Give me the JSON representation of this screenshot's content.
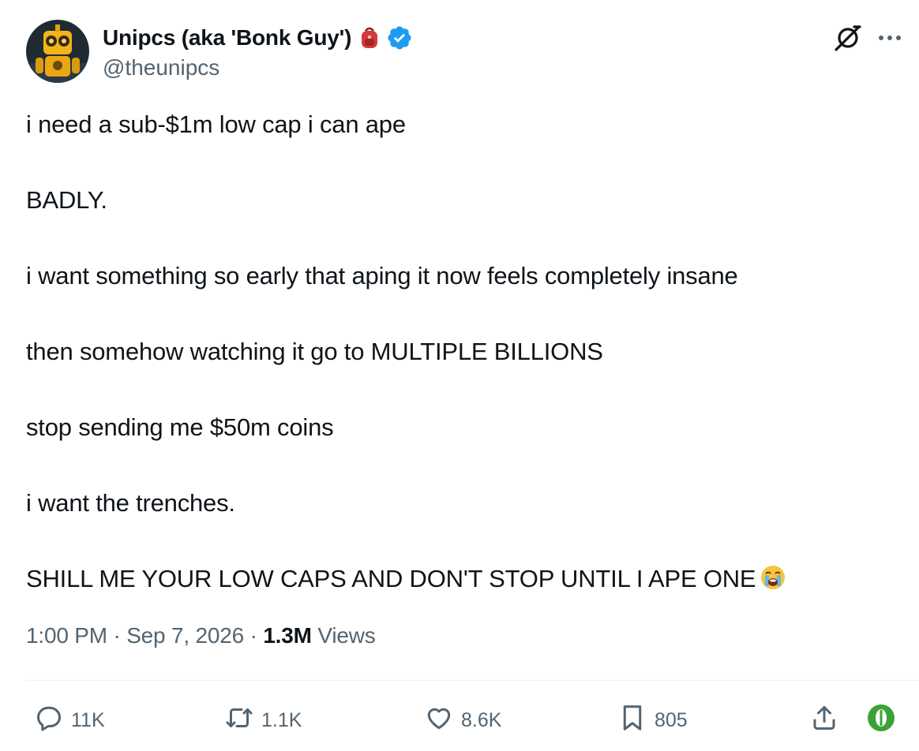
{
  "author": {
    "display_name": "Unipcs (aka 'Bonk Guy')",
    "handle": "@theunipcs",
    "name_emoji": "backpack-emoji",
    "verified_color": "#1d9bf0"
  },
  "tweet": {
    "lines": [
      "i need a sub-$1m low cap i can ape",
      "BADLY.",
      "i want something so early that aping it now feels completely insane",
      "then somehow watching it go to MULTIPLE BILLIONS",
      "stop sending me $50m coins",
      "i want the trenches.",
      "SHILL ME YOUR LOW CAPS AND DON'T STOP UNTIL I APE ONE"
    ],
    "trailing_emoji": "loudly-crying-face-emoji"
  },
  "meta": {
    "time": "1:00 PM",
    "sep1": " · ",
    "date": "Sep 7, 2026",
    "sep2": " · ",
    "views_count": "1.3M",
    "views_label": " Views"
  },
  "actions": {
    "replies": "11K",
    "reposts": "1.1K",
    "likes": "8.6K",
    "bookmarks": "805"
  },
  "colors": {
    "text": "#0f1419",
    "secondary": "#536471",
    "accent": "#1d9bf0",
    "extension": "#3aa335"
  }
}
